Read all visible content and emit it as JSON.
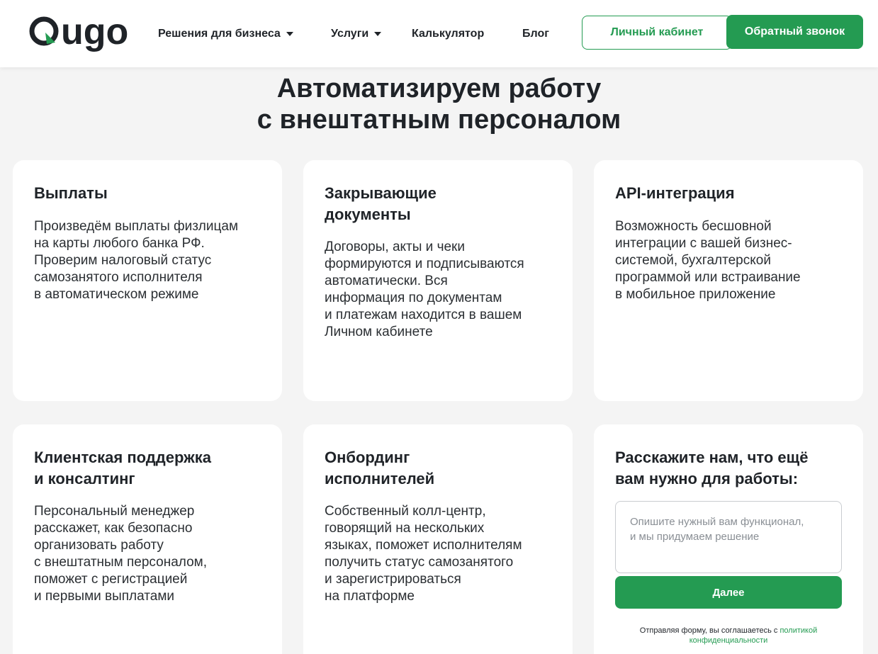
{
  "header": {
    "logo_text": "Qugo",
    "nav": [
      {
        "label": "Решения для бизнеса",
        "has_dropdown": true
      },
      {
        "label": "Услуги",
        "has_dropdown": true
      },
      {
        "label": "Калькулятор",
        "has_dropdown": false
      },
      {
        "label": "Блог",
        "has_dropdown": false
      }
    ],
    "cabinet_label": "Личный кабинет",
    "callback_label": "Обратный звонок"
  },
  "hero": {
    "title_line1": "Автоматизируем работу",
    "title_line2": "с внештатным персоналом"
  },
  "cards": [
    {
      "title_lines": [
        "Выплаты"
      ],
      "text_lines": [
        "Произведём выплаты физлицам",
        "на карты любого банка РФ.",
        "Проверим налоговый статус",
        "самозанятого исполнителя",
        "в автоматическом режиме"
      ]
    },
    {
      "title_lines": [
        "Закрывающие",
        "документы"
      ],
      "text_lines": [
        "Договоры, акты и чеки",
        "формируются и подписываются",
        "автоматически. Вся",
        "информация по документам",
        "и платежам находится в вашем",
        "Личном кабинете"
      ]
    },
    {
      "title_lines": [
        "API-интеграция"
      ],
      "text_lines": [
        "Возможность бесшовной",
        "интеграции с вашей бизнес-",
        "системой, бухгалтерской",
        "программой или встраивание",
        "в мобильное приложение"
      ]
    },
    {
      "title_lines": [
        "Клиентская поддержка",
        "и консалтинг"
      ],
      "text_lines": [
        "Персональный менеджер",
        "расскажет, как безопасно",
        "организовать работу",
        "с внештатным персоналом,",
        "поможет с регистрацией",
        "и первыми выплатами"
      ]
    },
    {
      "title_lines": [
        "Онбординг",
        "исполнителей"
      ],
      "text_lines": [
        "Собственный колл-центр,",
        "говорящий на нескольких",
        "языках, поможет исполнителям",
        "получить статус самозанятого",
        "и зарегистрироваться",
        "на платформе"
      ]
    }
  ],
  "form": {
    "title_line1": "Расскажите нам, что ещё",
    "title_line2": "вам нужно для работы:",
    "placeholder_line1": "Опишите нужный вам функционал,",
    "placeholder_line2": "и мы придумаем решение",
    "submit_label": "Далее",
    "consent_text": "Отправляя форму, вы соглашаетесь с ",
    "consent_link_line1": "политикой",
    "consent_link_line2": "конфиденциальности"
  },
  "colors": {
    "accent": "#249b52",
    "background": "#f4f4f4",
    "text": "#1f2328"
  }
}
